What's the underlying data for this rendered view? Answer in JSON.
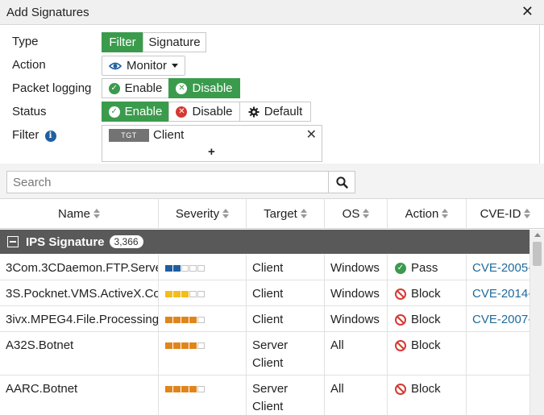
{
  "dialog": {
    "title": "Add Signatures"
  },
  "form": {
    "type_label": "Type",
    "type_options": [
      "Filter",
      "Signature"
    ],
    "type_selected": "Filter",
    "action_label": "Action",
    "action_value": "Monitor",
    "packet_logging_label": "Packet logging",
    "packet_logging_options": [
      "Enable",
      "Disable"
    ],
    "packet_logging_selected": "Disable",
    "status_label": "Status",
    "status_options": [
      "Enable",
      "Disable",
      "Default"
    ],
    "status_selected": "Enable",
    "filter_label": "Filter",
    "filter_tag": "TGT",
    "filter_value": "Client",
    "filter_add": "+"
  },
  "search": {
    "placeholder": "Search"
  },
  "table": {
    "columns": [
      "Name",
      "Severity",
      "Target",
      "OS",
      "Action",
      "CVE-ID"
    ],
    "group": {
      "label": "IPS Signature",
      "count": "3,366"
    },
    "rows": [
      {
        "name": "3Com.3CDaemon.FTP.Serve",
        "severity": 2,
        "target": "Client",
        "target2": "",
        "os": "Windows",
        "action": "Pass",
        "cve": "CVE-2005-"
      },
      {
        "name": "3S.Pocknet.VMS.ActiveX.Co",
        "severity": 3,
        "target": "Client",
        "target2": "",
        "os": "Windows",
        "action": "Block",
        "cve": "CVE-2014-"
      },
      {
        "name": "3ivx.MPEG4.File.Processing",
        "severity": 4,
        "target": "Client",
        "target2": "",
        "os": "Windows",
        "action": "Block",
        "cve": "CVE-2007-"
      },
      {
        "name": "A32S.Botnet",
        "severity": 4,
        "target": "Server",
        "target2": "Client",
        "os": "All",
        "action": "Block",
        "cve": ""
      },
      {
        "name": "AARC.Botnet",
        "severity": 4,
        "target": "Server",
        "target2": "Client",
        "os": "All",
        "action": "Block",
        "cve": ""
      }
    ]
  },
  "colors": {
    "accent_green": "#3b9b4d",
    "block_red": "#d43a34",
    "severity_low": "#1f5fa0",
    "severity_medium": "#f2bd1d",
    "severity_high": "#e0851c",
    "group_bg": "#595959",
    "link_blue": "#1f6a9c"
  },
  "icons": {
    "close": "close-icon",
    "monitor": "eye-icon",
    "dropdown": "caret-down-icon",
    "enable": "check-circle-icon",
    "disable": "x-circle-icon",
    "default": "gear-icon",
    "info": "info-icon",
    "search": "search-icon",
    "sort": "sort-icon",
    "collapse": "minus-square-icon",
    "pass": "check-circle-icon",
    "block": "block-icon"
  }
}
